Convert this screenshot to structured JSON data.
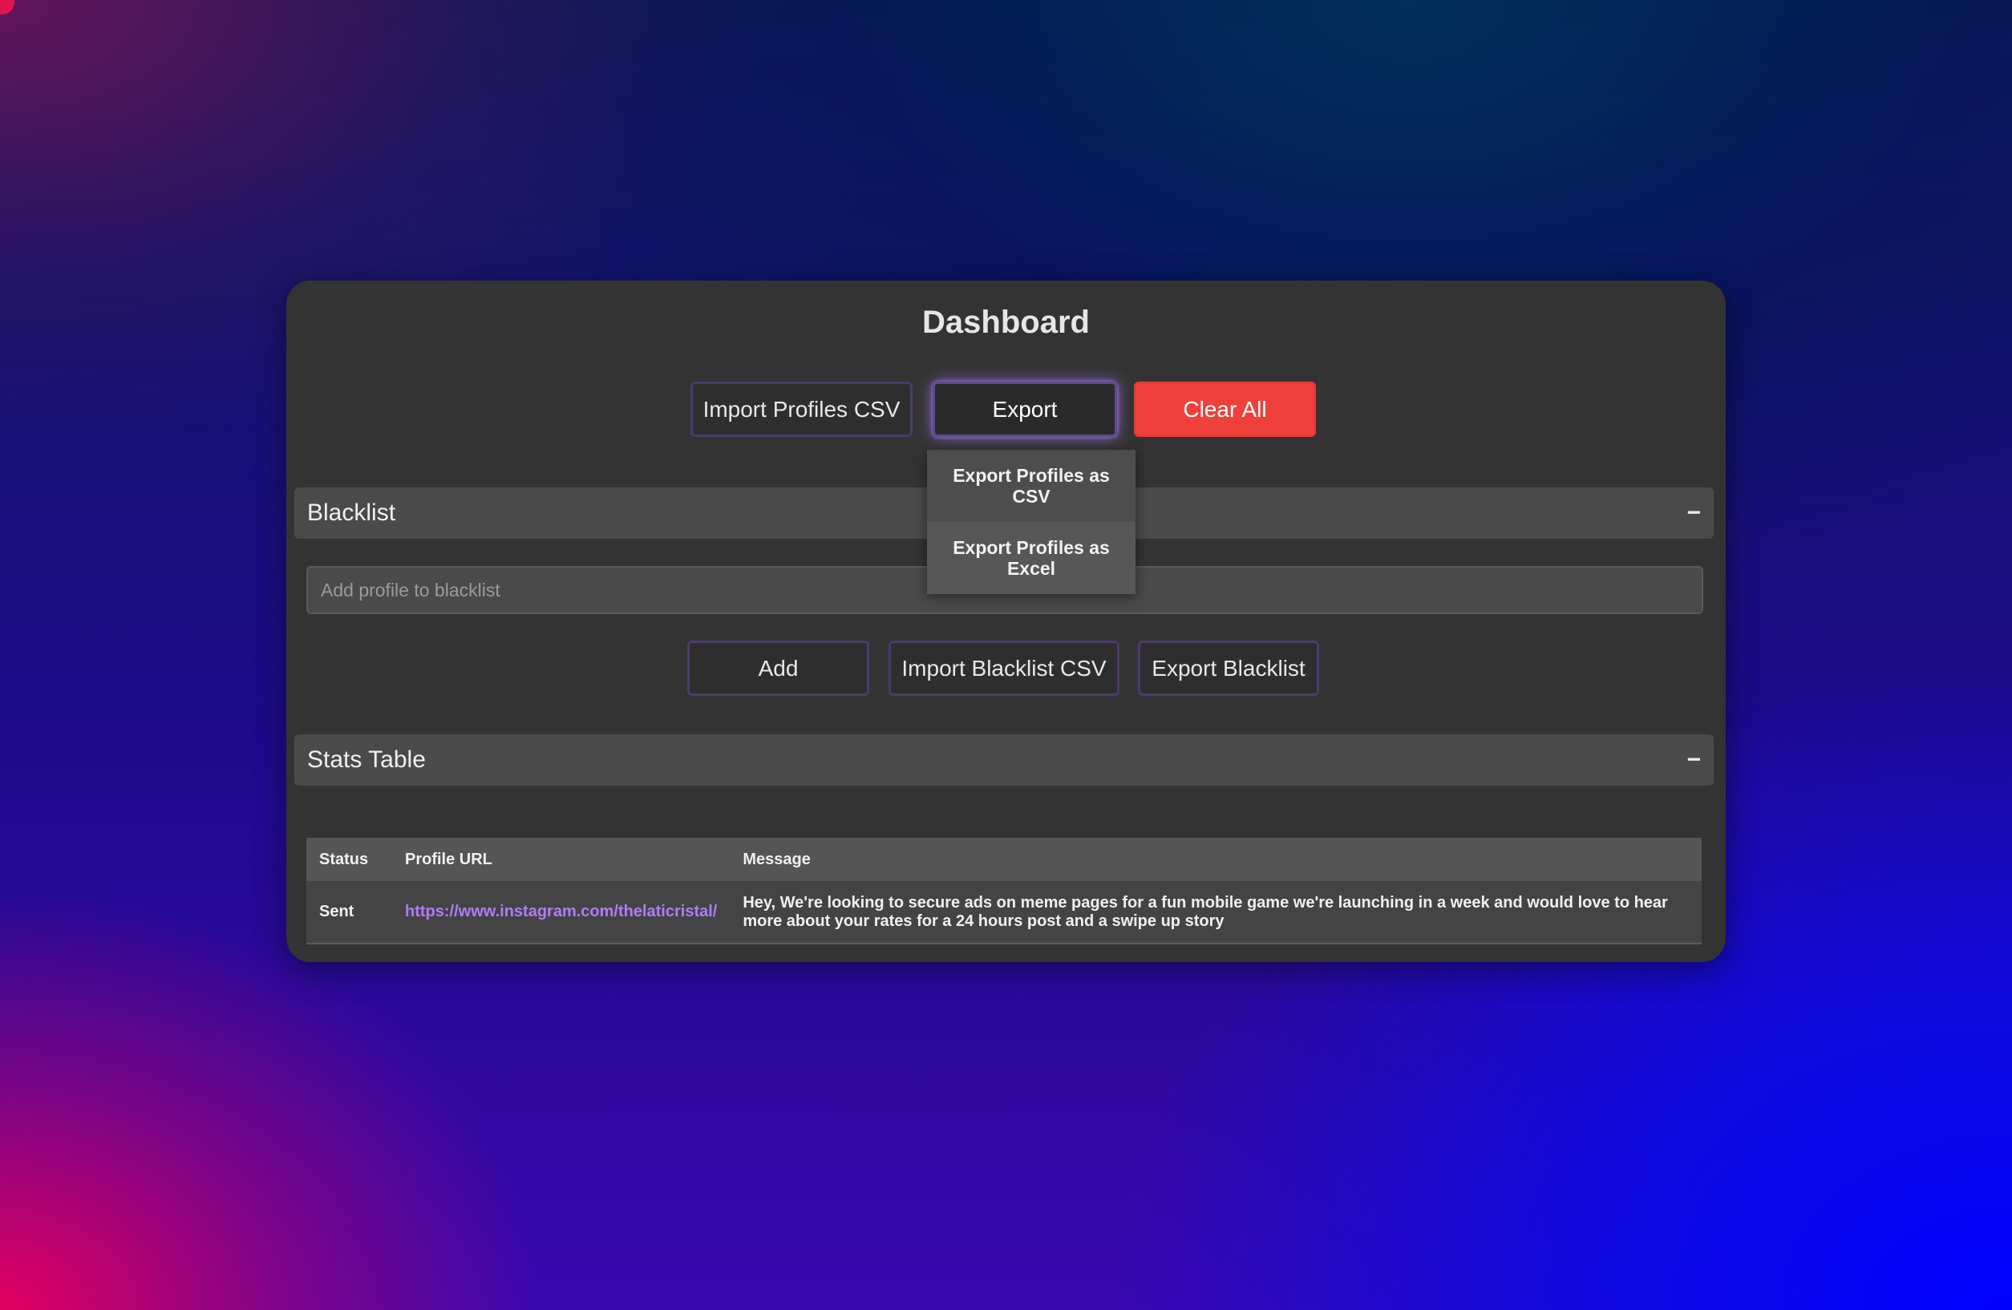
{
  "colors": {
    "accent": "#b07cf5",
    "danger": "#f0403c",
    "panel": "#333333"
  },
  "dashboard": {
    "title": "Dashboard",
    "toolbar": {
      "import_label": "Import Profiles CSV",
      "export_label": "Export",
      "clear_label": "Clear All"
    },
    "export_menu": {
      "items": [
        {
          "label": "Export Profiles as CSV"
        },
        {
          "label": "Export Profiles as Excel"
        }
      ]
    }
  },
  "blacklist": {
    "title": "Blacklist",
    "collapse_symbol": "−",
    "input_placeholder": "Add profile to blacklist",
    "add_label": "Add",
    "import_label": "Import Blacklist CSV",
    "export_label": "Export Blacklist"
  },
  "stats": {
    "title": "Stats Table",
    "collapse_symbol": "−",
    "columns": [
      "Status",
      "Profile URL",
      "Message"
    ],
    "rows": [
      {
        "status": "Sent",
        "url": "https://www.instagram.com/thelaticristal/",
        "message": "Hey, We're looking to secure ads on meme pages for a fun mobile game we're launching in a week and would love to hear more about your rates for a 24 hours post and a swipe up story"
      }
    ]
  }
}
